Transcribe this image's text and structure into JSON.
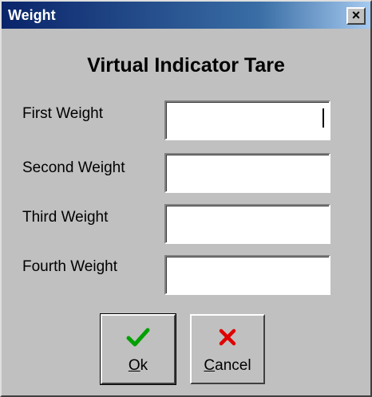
{
  "window": {
    "title": "Weight",
    "close_glyph": "×"
  },
  "heading": "Virtual Indicator Tare",
  "fields": [
    {
      "label": "First Weight",
      "value": ""
    },
    {
      "label": "Second Weight",
      "value": ""
    },
    {
      "label": "Third Weight",
      "value": ""
    },
    {
      "label": "Fourth Weight",
      "value": ""
    }
  ],
  "buttons": {
    "ok": {
      "accel": "O",
      "rest": "k",
      "icon": "checkmark-icon",
      "icon_color": "#00a000"
    },
    "cancel": {
      "accel": "C",
      "rest": "ancel",
      "icon": "x-icon",
      "icon_color": "#e00000"
    }
  }
}
